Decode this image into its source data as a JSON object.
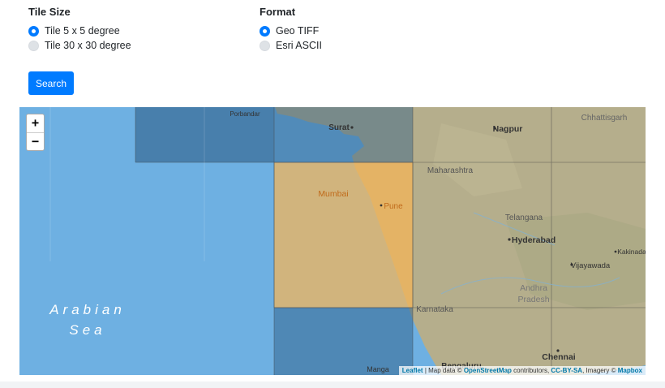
{
  "tile_size": {
    "title": "Tile Size",
    "options": [
      {
        "label": "Tile 5 x 5 degree",
        "checked": true
      },
      {
        "label": "Tile 30 x 30 degree",
        "checked": false
      }
    ]
  },
  "format": {
    "title": "Format",
    "options": [
      {
        "label": "Geo TIFF",
        "checked": true
      },
      {
        "label": "Esri ASCII",
        "checked": false
      }
    ]
  },
  "search_label": "Search",
  "map": {
    "zoom_in": "+",
    "zoom_out": "−",
    "labels": {
      "porbandar": "Porbandar",
      "surat": "Surat",
      "nagpur": "Nagpur",
      "chhattisgarh": "Chhattisgarh",
      "maharashtra": "Maharashtra",
      "mumbai": "Mumbai",
      "pune": "Pune",
      "telangana": "Telangana",
      "hyderabad": "Hyderabad",
      "kakinada": "Kakinada",
      "vijayawada": "Vijayawada",
      "andhra": "Andhra",
      "pradesh": "Pradesh",
      "karnataka": "Karnataka",
      "chennai": "Chennai",
      "arabian": "Arabian",
      "sea": "Sea",
      "bengaluru": "Bengaluru",
      "mangalore": "Manga"
    },
    "attribution": {
      "leaflet": "Leaflet",
      "text1": " | Map data © ",
      "osm": "OpenStreetMap",
      "text2": " contributors, ",
      "license": "CC-BY-SA",
      "text3": ", Imagery © ",
      "mapbox": "Mapbox"
    },
    "colors": {
      "sea": "#6eb0e2",
      "land": "#b5ae8c",
      "selected_tile": "#f7b657",
      "tile_dark": "#3a6f9a"
    }
  }
}
